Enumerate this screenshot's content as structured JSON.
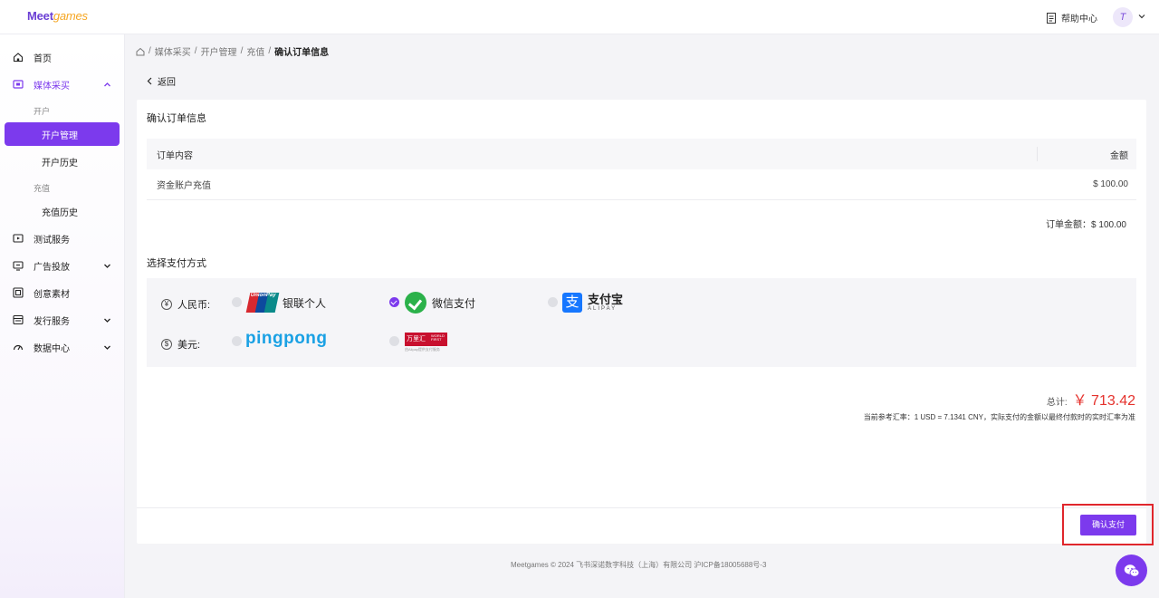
{
  "brand": {
    "meet": "Meet",
    "games": "games"
  },
  "header": {
    "help_label": "帮助中心",
    "avatar_initial": "T"
  },
  "sidebar": {
    "home": "首页",
    "media_buy": "媒体采买",
    "group_open": "开户",
    "open_manage": "开户管理",
    "open_history": "开户历史",
    "group_recharge": "充值",
    "recharge_history": "充值历史",
    "test_service": "测试服务",
    "ad_delivery": "广告投放",
    "creative": "创意素材",
    "publish_service": "发行服务",
    "data_center": "数据中心"
  },
  "breadcrumb": {
    "items": [
      "媒体采买",
      "开户管理",
      "充值"
    ],
    "current": "确认订单信息",
    "sep": "/"
  },
  "back_label": "返回",
  "order": {
    "title": "确认订单信息",
    "col_content": "订单内容",
    "col_amount": "金额",
    "rows": [
      {
        "content": "资金账户充值",
        "amount": "$ 100.00"
      }
    ],
    "total_label": "订单金额：$ 100.00"
  },
  "payment": {
    "title": "选择支付方式",
    "rmb_label": "人民币:",
    "usd_label": "美元:",
    "rmb_symbol": "¥",
    "usd_symbol": "$",
    "unionpay_label": "银联个人",
    "unionpay_logo_text": "UnionPay",
    "wechat_label": "微信支付",
    "alipay_zh": "支付宝",
    "alipay_en": "ALIPAY",
    "alipay_glyph": "支",
    "pingpong_label": "pingpong",
    "worldfirst_label": "万里汇",
    "worldfirst_en": "WORLD FIRST",
    "worldfirst_sub": "由Alipay提供支付服务",
    "selected": "wechat"
  },
  "summary": {
    "total_label": "总计:",
    "total_amount": "￥ 713.42",
    "rate_note": "当前参考汇率：1 USD = 7.1341 CNY，实际支付的金额以最终付款时的实时汇率为准"
  },
  "confirm_label": "确认支付",
  "footer": {
    "copyright": "Meetgames © 2024 飞书深诺数字科技（上海）有限公司 沪ICP备18005688号-3"
  },
  "colors": {
    "accent": "#7c3aed",
    "price": "#e5322d",
    "highlight_frame": "#e0262c"
  }
}
